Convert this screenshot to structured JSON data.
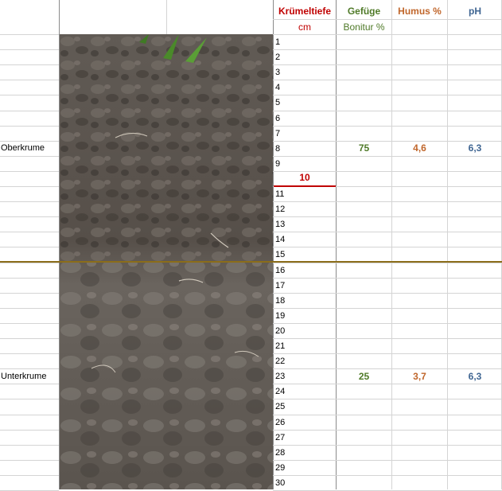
{
  "headers": {
    "depth_title": "Krümeltiefe",
    "depth_unit": "cm",
    "structure_title": "Gefüge",
    "structure_unit": "Bonitur %",
    "humus_title": "Humus %",
    "ph_title": "pH"
  },
  "colors": {
    "depth": "#c00000",
    "structure": "#4f7a28",
    "humus": "#c0662b",
    "ph": "#3f6592",
    "separator": "#8b6d1a"
  },
  "layers": [
    {
      "label": "Oberkrume",
      "structure": "75",
      "humus": "4,6",
      "ph": "6,3"
    },
    {
      "label": "Unterkrume",
      "structure": "25",
      "humus": "3,7",
      "ph": "6,3"
    }
  ],
  "depths": [
    "1",
    "2",
    "3",
    "4",
    "5",
    "6",
    "7",
    "8",
    "9",
    "10",
    "11",
    "12",
    "13",
    "14",
    "15",
    "16",
    "17",
    "18",
    "19",
    "20",
    "21",
    "22",
    "23",
    "24",
    "25",
    "26",
    "27",
    "28",
    "29",
    "30"
  ],
  "crumb_depth_marker": "10",
  "photo": {
    "description_icon": "soil-profile-photo"
  }
}
